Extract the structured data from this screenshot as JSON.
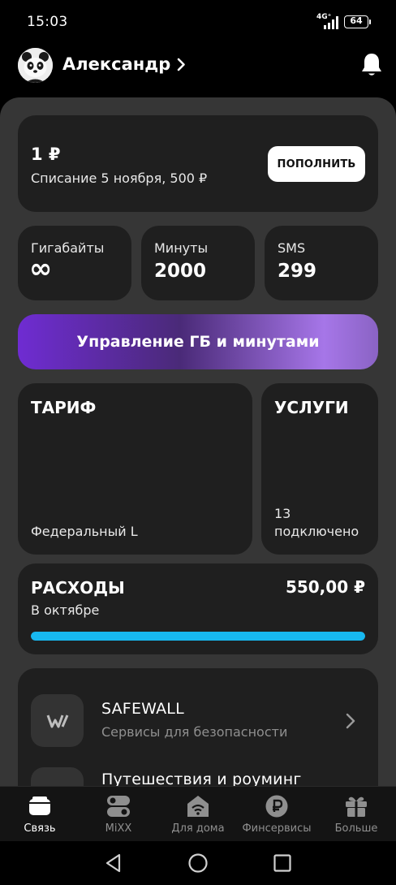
{
  "status_bar": {
    "time": "15:03",
    "network": "4G⁺",
    "battery": "64"
  },
  "header": {
    "user_name": "Александр"
  },
  "balance": {
    "amount": "1 ₽",
    "subtitle": "Списание 5 ноября, 500 ₽",
    "topup_label": "ПОПОЛНИТЬ"
  },
  "stats": [
    {
      "label": "Гигабайты",
      "value": "∞"
    },
    {
      "label": "Минуты",
      "value": "2000"
    },
    {
      "label": "SMS",
      "value": "299"
    }
  ],
  "manage_button": "Управление ГБ и минутами",
  "tariff": {
    "title": "ТАРИФ",
    "name": "Федеральный L"
  },
  "services": {
    "title": "УСЛУГИ",
    "count": "13",
    "status": "подключено"
  },
  "expenses": {
    "title": "РАСХОДЫ",
    "amount": "550,00 ₽",
    "period": "В октябре",
    "progress": 1.0
  },
  "list": [
    {
      "title": "SAFEWALL",
      "subtitle": "Сервисы для безопасности",
      "icon": "safewall-logo-icon"
    },
    {
      "title": "Путешествия и роуминг",
      "subtitle": "",
      "icon": "travel-icon"
    }
  ],
  "bottom_nav": [
    {
      "label": "Связь",
      "icon": "wallet-icon",
      "active": true
    },
    {
      "label": "MiXX",
      "icon": "mixx-icon",
      "active": false
    },
    {
      "label": "Для дома",
      "icon": "home-wifi-icon",
      "active": false
    },
    {
      "label": "Финсервисы",
      "icon": "ruble-icon",
      "active": false
    },
    {
      "label": "Больше",
      "icon": "gift-icon",
      "active": false
    }
  ],
  "colors": {
    "background": "#000000",
    "sheet": "#363636",
    "card": "#1f1f1f",
    "accent_bar": "#17b8f0",
    "gradient_start": "#6f2cd2",
    "gradient_end": "#a676e8"
  }
}
